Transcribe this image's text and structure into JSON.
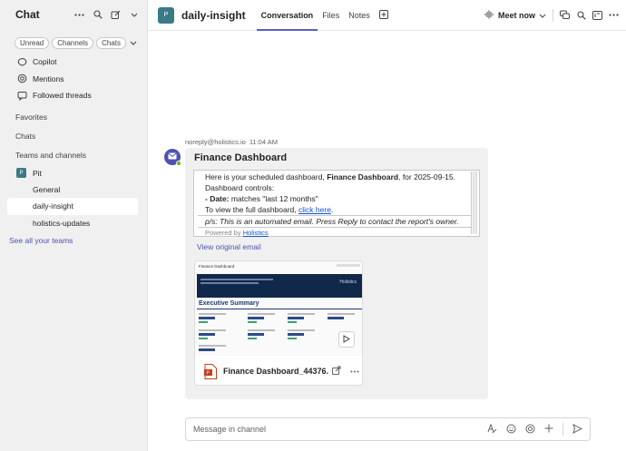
{
  "sidebar": {
    "title": "Chat",
    "filters": [
      "Unread",
      "Channels",
      "Chats"
    ],
    "items": [
      {
        "label": "Copilot",
        "icon": "copilot-icon"
      },
      {
        "label": "Mentions",
        "icon": "at-icon"
      },
      {
        "label": "Followed threads",
        "icon": "thread-icon"
      }
    ],
    "sections": {
      "favorites": "Favorites",
      "chats": "Chats",
      "teams": "Teams and channels"
    },
    "team": {
      "avatar": "P",
      "name": "Pit"
    },
    "channels": [
      "General",
      "daily-insight",
      "holistics-updates"
    ],
    "see_all": "See all your teams"
  },
  "header": {
    "avatar": "P",
    "channel_name": "daily-insight",
    "tabs": [
      "Conversation",
      "Files",
      "Notes"
    ],
    "active_tab": "Conversation",
    "meet_label": "Meet now"
  },
  "message": {
    "sender": "noreply@holistics.io",
    "time": "11:04 AM",
    "card_title": "Finance Dashboard",
    "email": {
      "line1_prefix": "Here is your scheduled dashboard, ",
      "line1_bold": "Finance Dashboard",
      "line1_suffix": ", for 2025-09-15.",
      "line2": "Dashboard controls:",
      "line3_bold": "- Date:",
      "line3_rest": " matches \"last 12 months\"",
      "line4_prefix": "To view the full dashboard, ",
      "line4_link": "click here",
      "line4_suffix": ".",
      "line5": "p/s: This is an automated email. Press Reply to contact the report's owner.",
      "powered_prefix": "Powered by ",
      "powered_link": "Holistics"
    },
    "view_original": "View original email",
    "attachment": {
      "preview_title": "Finance Dashboard",
      "preview_logo": "Holistics",
      "preview_heading": "Executive Summary",
      "file_name": "Finance Dashboard_44376..."
    }
  },
  "compose": {
    "placeholder": "Message in channel"
  },
  "colors": {
    "accent": "#5b5fc7",
    "team": "#3b7a84",
    "link": "#4f52b2"
  }
}
